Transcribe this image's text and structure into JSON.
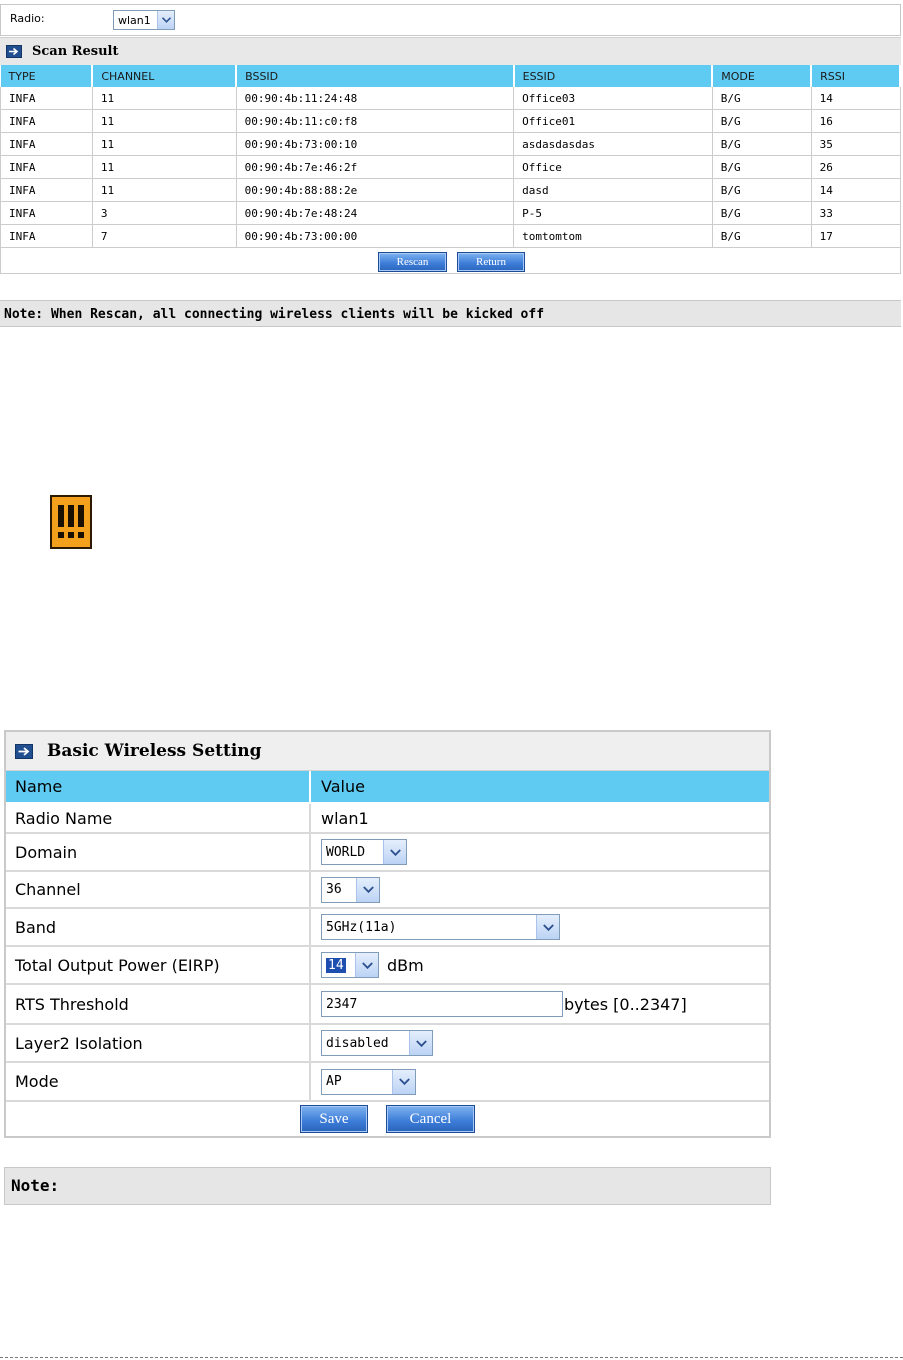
{
  "scan_panel": {
    "radio_label": "Radio:",
    "radio_value": "wlan1",
    "title": "Scan Result",
    "columns": [
      "TYPE",
      "CHANNEL",
      "BSSID",
      "ESSID",
      "MODE",
      "RSSI"
    ],
    "rows": [
      [
        "INFA",
        "11",
        "00:90:4b:11:24:48",
        "Office03",
        "B/G",
        "14"
      ],
      [
        "INFA",
        "11",
        "00:90:4b:11:c0:f8",
        "Office01",
        "B/G",
        "16"
      ],
      [
        "INFA",
        "11",
        "00:90:4b:73:00:10",
        "asdasdasdas",
        "B/G",
        "35"
      ],
      [
        "INFA",
        "11",
        "00:90:4b:7e:46:2f",
        "Office",
        "B/G",
        "26"
      ],
      [
        "INFA",
        "11",
        "00:90:4b:88:88:2e",
        "dasd",
        "B/G",
        "14"
      ],
      [
        "INFA",
        "3",
        "00:90:4b:7e:48:24",
        "P-5",
        "B/G",
        "33"
      ],
      [
        "INFA",
        "7",
        "00:90:4b:73:00:00",
        "tomtomtom",
        "B/G",
        "17"
      ]
    ],
    "rescan_label": "Rescan",
    "return_label": "Return",
    "note": "Note: When Rescan, all connecting wireless clients will be kicked off"
  },
  "warning_icon": "warning-icon",
  "basic_wireless": {
    "title": "Basic Wireless Setting",
    "header_name": "Name",
    "header_value": "Value",
    "radio_name_label": "Radio Name",
    "radio_name_value": "wlan1",
    "domain_label": "Domain",
    "domain_value": "WORLD",
    "channel_label": "Channel",
    "channel_value": "36",
    "band_label": "Band",
    "band_value": "5GHz(11a)",
    "power_label": "Total Output Power (EIRP)",
    "power_value": "14",
    "power_unit": "dBm",
    "rts_label": "RTS Threshold",
    "rts_value": "2347",
    "rts_unit": "bytes [0..2347]",
    "isolation_label": "Layer2 Isolation",
    "isolation_value": "disabled",
    "mode_label": "Mode",
    "mode_value": "AP",
    "save_label": "Save",
    "cancel_label": "Cancel",
    "note": "Note:"
  },
  "colors": {
    "table_header": "#5fcbf2",
    "panel_header": "#e8e8e8",
    "button": "#3b7bd7",
    "warning": "#f3a11c"
  }
}
